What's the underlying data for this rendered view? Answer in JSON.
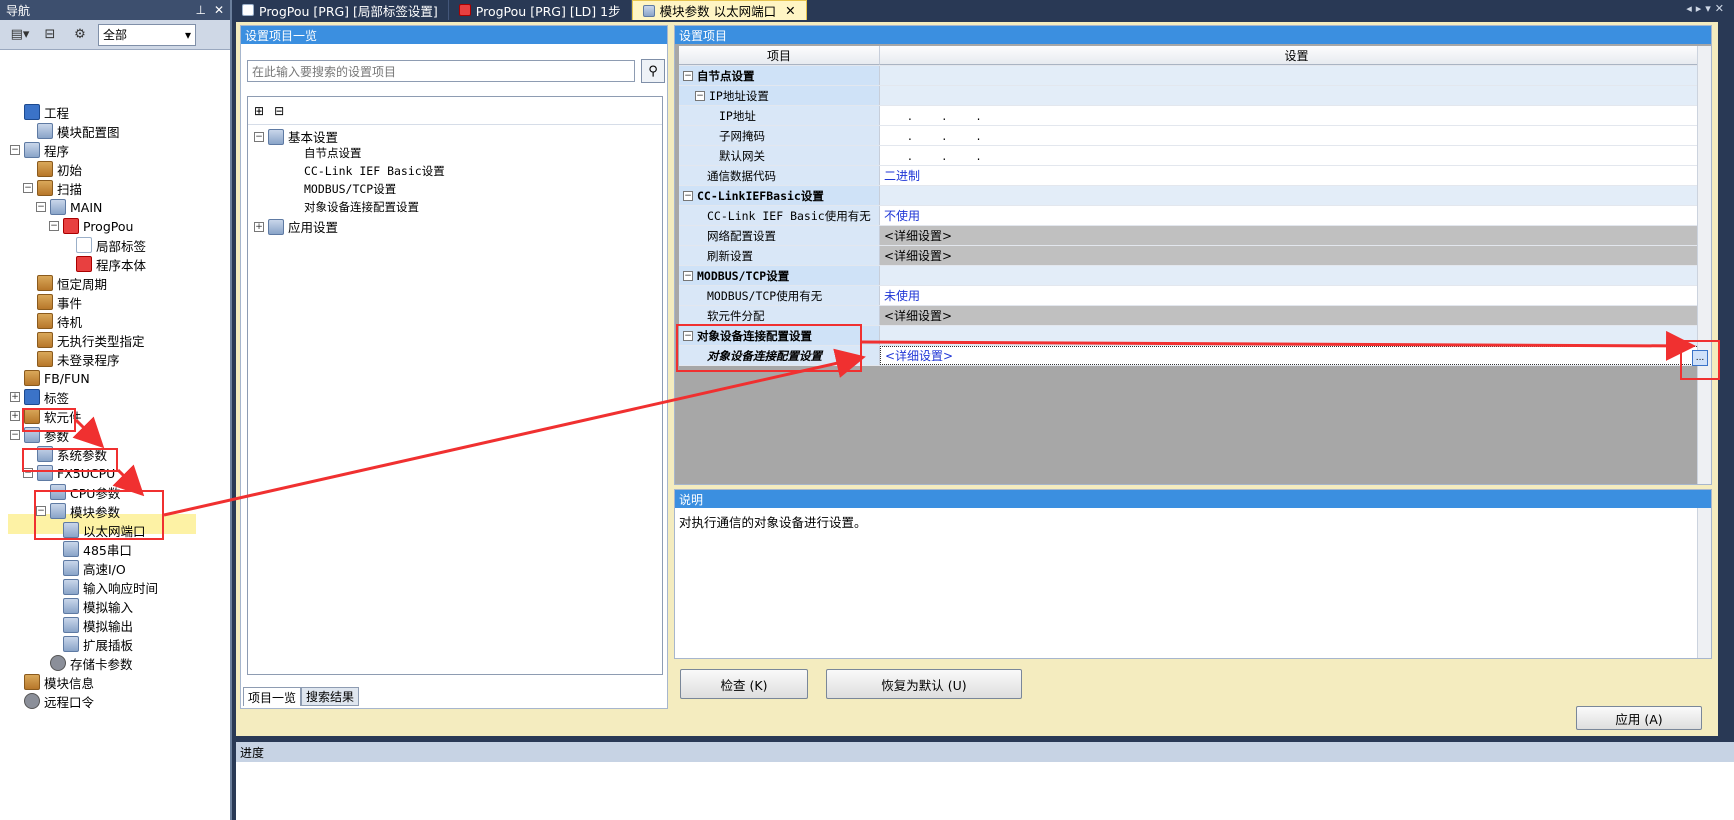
{
  "navigator": {
    "title": "导航",
    "filter": "全部",
    "tree": [
      {
        "label": "工程",
        "level": 0,
        "icon": "project-icon",
        "expander": ""
      },
      {
        "label": "模块配置图",
        "level": 1,
        "icon": "module-config-icon",
        "expander": ""
      },
      {
        "label": "程序",
        "level": 0,
        "icon": "program-folder-icon",
        "expander": "−"
      },
      {
        "label": "初始",
        "level": 1,
        "icon": "folder-icon",
        "expander": ""
      },
      {
        "label": "扫描",
        "level": 1,
        "icon": "folder-icon",
        "expander": "−"
      },
      {
        "label": "MAIN",
        "level": 2,
        "icon": "task-icon",
        "expander": "−"
      },
      {
        "label": "ProgPou",
        "level": 3,
        "icon": "pou-icon",
        "expander": "−"
      },
      {
        "label": "局部标签",
        "level": 4,
        "icon": "label-icon",
        "expander": ""
      },
      {
        "label": "程序本体",
        "level": 4,
        "icon": "program-body-icon",
        "expander": ""
      },
      {
        "label": "恒定周期",
        "level": 1,
        "icon": "folder-icon",
        "expander": ""
      },
      {
        "label": "事件",
        "level": 1,
        "icon": "folder-icon",
        "expander": ""
      },
      {
        "label": "待机",
        "level": 1,
        "icon": "folder-icon",
        "expander": ""
      },
      {
        "label": "无执行类型指定",
        "level": 1,
        "icon": "folder-icon",
        "expander": ""
      },
      {
        "label": "未登录程序",
        "level": 1,
        "icon": "folder-icon",
        "expander": ""
      },
      {
        "label": "FB/FUN",
        "level": 0,
        "icon": "fb-icon",
        "expander": ""
      },
      {
        "label": "标签",
        "level": 0,
        "icon": "label-folder-icon",
        "expander": "+"
      },
      {
        "label": "软元件",
        "level": 0,
        "icon": "device-icon",
        "expander": "+"
      },
      {
        "label": "参数",
        "level": 0,
        "icon": "parameter-icon",
        "expander": "−"
      },
      {
        "label": "系统参数",
        "level": 1,
        "icon": "parameter-icon",
        "expander": ""
      },
      {
        "label": "FX5UCPU",
        "level": 1,
        "icon": "parameter-icon",
        "expander": "−"
      },
      {
        "label": "CPU参数",
        "level": 2,
        "icon": "parameter-icon",
        "expander": ""
      },
      {
        "label": "模块参数",
        "level": 2,
        "icon": "parameter-icon",
        "expander": "−"
      },
      {
        "label": "以太网端口",
        "level": 3,
        "icon": "ethernet-icon",
        "expander": ""
      },
      {
        "label": "485串口",
        "level": 3,
        "icon": "parameter-icon",
        "expander": ""
      },
      {
        "label": "高速I/O",
        "level": 3,
        "icon": "parameter-icon",
        "expander": ""
      },
      {
        "label": "输入响应时间",
        "level": 3,
        "icon": "parameter-icon",
        "expander": ""
      },
      {
        "label": "模拟输入",
        "level": 3,
        "icon": "parameter-icon",
        "expander": ""
      },
      {
        "label": "模拟输出",
        "level": 3,
        "icon": "parameter-icon",
        "expander": ""
      },
      {
        "label": "扩展插板",
        "level": 3,
        "icon": "parameter-icon",
        "expander": ""
      },
      {
        "label": "存储卡参数",
        "level": 2,
        "icon": "memory-card-icon",
        "expander": ""
      },
      {
        "label": "模块信息",
        "level": 0,
        "icon": "module-info-icon",
        "expander": ""
      },
      {
        "label": "远程口令",
        "level": 0,
        "icon": "remote-password-icon",
        "expander": ""
      }
    ]
  },
  "tabs": [
    {
      "label": "ProgPou [PRG] [局部标签设置]"
    },
    {
      "label": "ProgPou [PRG] [LD] 1步"
    },
    {
      "label": "模块参数 以太网端口",
      "close": "✕"
    }
  ],
  "left_panel": {
    "title": "设置项目一览",
    "search_placeholder": "在此输入要搜索的设置项目",
    "tree": {
      "basic": "基本设置",
      "basic_children": [
        "自节点设置",
        "CC-Link IEF Basic设置",
        "MODBUS/TCP设置",
        "对象设备连接配置设置"
      ],
      "app": "应用设置"
    },
    "tab_items": "项目一览",
    "tab_search": "搜索结果"
  },
  "right_panel": {
    "title": "设置项目",
    "col_item": "项目",
    "col_setting": "设置",
    "rows": [
      {
        "item": "自节点设置",
        "value": "",
        "kind": "section",
        "expander": "−"
      },
      {
        "item": "IP地址设置",
        "value": "",
        "kind": "subsection",
        "expander": "−"
      },
      {
        "item": "IP地址",
        "value": ".        .        .",
        "kind": "leaf3"
      },
      {
        "item": "子网掩码",
        "value": ".        .        .",
        "kind": "leaf3"
      },
      {
        "item": "默认网关",
        "value": ".        .        .",
        "kind": "leaf3"
      },
      {
        "item": "通信数据代码",
        "value": "二进制",
        "kind": "leaf2",
        "blue": true
      },
      {
        "item": "CC-LinkIEFBasic设置",
        "value": "",
        "kind": "section",
        "expander": "−"
      },
      {
        "item": "CC-Link IEF Basic使用有无",
        "value": "不使用",
        "kind": "leaf2",
        "blue": true
      },
      {
        "item": "网络配置设置",
        "value": "<详细设置>",
        "kind": "leaf2",
        "gray": true
      },
      {
        "item": "刷新设置",
        "value": "<详细设置>",
        "kind": "leaf2",
        "gray": true
      },
      {
        "item": "MODBUS/TCP设置",
        "value": "",
        "kind": "section",
        "expander": "−"
      },
      {
        "item": "MODBUS/TCP使用有无",
        "value": "未使用",
        "kind": "leaf2",
        "blue": true
      },
      {
        "item": "软元件分配",
        "value": "<详细设置>",
        "kind": "leaf2",
        "gray": true
      },
      {
        "item": "对象设备连接配置设置",
        "value": "",
        "kind": "section",
        "expander": "−"
      },
      {
        "item": "对象设备连接配置设置",
        "value": "<详细设置>",
        "kind": "leaf2sel",
        "blue": true
      }
    ],
    "ellipsis": "..."
  },
  "description": {
    "title": "说明",
    "text": "对执行通信的对象设备进行设置。"
  },
  "buttons": {
    "check": "检查 (K)",
    "restore": "恢复为默认 (U)",
    "apply": "应用 (A)"
  },
  "progress": {
    "title": "进度"
  },
  "colors": {
    "title_bar": "#3b8fe0",
    "annotation_red": "#f03030",
    "selected_row": "#fdf2a5"
  }
}
